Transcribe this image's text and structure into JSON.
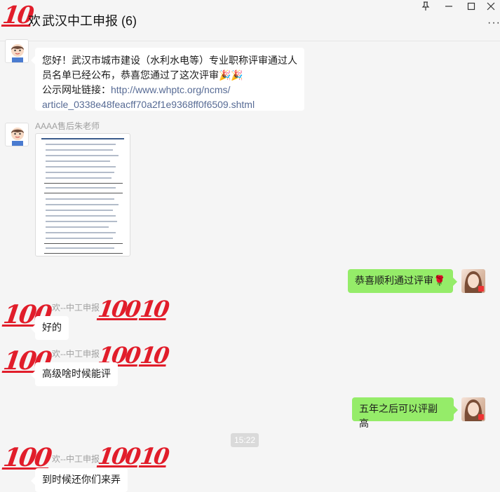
{
  "window": {
    "title": "武汉中工申报 (6)",
    "title_prefix": "欢",
    "pin_icon": "pin-icon",
    "minimize_icon": "minimize-icon",
    "maximize_icon": "maximize-icon",
    "close_icon": "close-icon",
    "more_label": "···"
  },
  "messages": {
    "m1": {
      "text_line1": "您好！武汉市城市建设（水利水电等）专业职称评审通过人",
      "text_line2": "员名单已经公布，恭喜您通过了这次评审🎉🎉",
      "link_prefix": "公示网址链接：",
      "link_part1": "http://www.whptc.org/ncms/",
      "link_part2": "article_0338e48feacff70a2f1e9368ff0f6509.shtml"
    },
    "m2": {
      "sender": "AAAA售后朱老师"
    },
    "m3": {
      "text": "恭喜顺利通过评审🌹"
    },
    "m4": {
      "sender": "欢--中工申报",
      "text": "好的"
    },
    "m5": {
      "sender": "欢--中工申报",
      "text": "高级啥时候能评"
    },
    "m6": {
      "text": "五年之后可以评副高"
    },
    "timestamp": "15:22",
    "m7": {
      "sender": "欢--中工申报",
      "text": "到时候还你们来弄"
    }
  },
  "stickers": {
    "hundred": "100",
    "partial": "10"
  },
  "colors": {
    "background": "#f5f5f5",
    "bubble_self": "#95ec69",
    "bubble_other": "#ffffff",
    "link": "#576b95",
    "sticker_red": "#e11d2a"
  }
}
